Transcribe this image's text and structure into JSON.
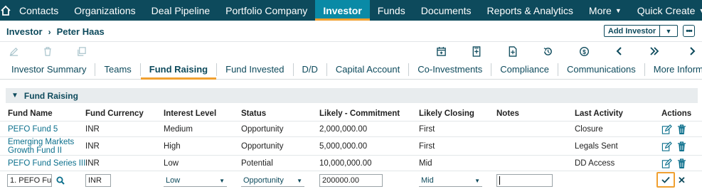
{
  "nav": {
    "items": [
      "Contacts",
      "Organizations",
      "Deal Pipeline",
      "Portfolio Company",
      "Investor",
      "Funds",
      "Documents",
      "Reports & Analytics",
      "More",
      "Quick Create"
    ],
    "active": "Investor"
  },
  "header": {
    "breadcrumb_root": "Investor",
    "breadcrumb_current": "Peter Haas",
    "add_button": "Add Investor",
    "more_button": "•••"
  },
  "tabs": [
    "Investor Summary",
    "Teams",
    "Fund Raising",
    "Fund Invested",
    "D/D",
    "Capital Account",
    "Co-Investments",
    "Compliance",
    "Communications",
    "More Information"
  ],
  "active_tab": "Fund Raising",
  "section": {
    "title": "Fund Raising"
  },
  "table": {
    "headers": [
      "Fund Name",
      "Fund Currency",
      "Interest Level",
      "Status",
      "Likely - Commitment",
      "Likely Closing",
      "Notes",
      "Last Activity",
      "Actions"
    ],
    "rows": [
      [
        "PEFO Fund 5",
        "INR",
        "Medium",
        "Opportunity",
        "2,000,000.00",
        "First",
        "",
        "Closure"
      ],
      [
        "Emerging Markets Growth Fund II",
        "INR",
        "High",
        "Opportunity",
        "5,000,000.00",
        "First",
        "",
        "Legals Sent"
      ],
      [
        "PEFO Fund Series III",
        "INR",
        "Low",
        "Potential",
        "10,000,000.00",
        "Mid",
        "",
        "DD Access"
      ]
    ],
    "edit_row": {
      "fund_name": "1. PEFO Fu",
      "currency": "INR",
      "interest_level": "Low",
      "status": "Opportunity",
      "commitment": "200000.00",
      "closing": "Mid",
      "notes": ""
    }
  },
  "colors": {
    "nav_bg": "#0d4a5c",
    "active_tab": "#0a8aa6",
    "accent": "#f0a030",
    "link": "#0b6f8c"
  }
}
